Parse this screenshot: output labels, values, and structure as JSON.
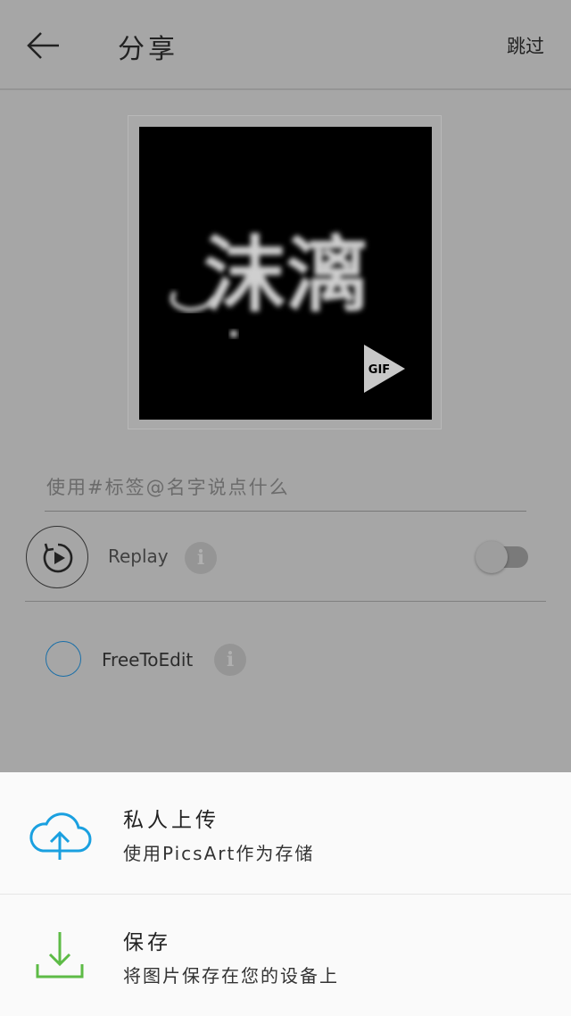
{
  "header": {
    "title": "分享",
    "skip_label": "跳过"
  },
  "preview": {
    "art_text": "沫漓",
    "gif_badge": "GIF"
  },
  "caption": {
    "placeholder": "使用#标签@名字说点什么"
  },
  "replay": {
    "label": "Replay",
    "enabled": false
  },
  "free_to_edit": {
    "label": "FreeToEdit",
    "checked": false
  },
  "sheet": {
    "items": [
      {
        "title": "私人上传",
        "subtitle": "使用PicsArt作为存储",
        "icon": "cloud-upload-icon",
        "color": "#1aa0e0"
      },
      {
        "title": "保存",
        "subtitle": "将图片保存在您的设备上",
        "icon": "download-icon",
        "color": "#5dbb46"
      }
    ]
  },
  "colors": {
    "overlay_bg": "#a6a6a6",
    "sheet_bg": "#fafafa",
    "check_ring": "#1a6fa8"
  }
}
